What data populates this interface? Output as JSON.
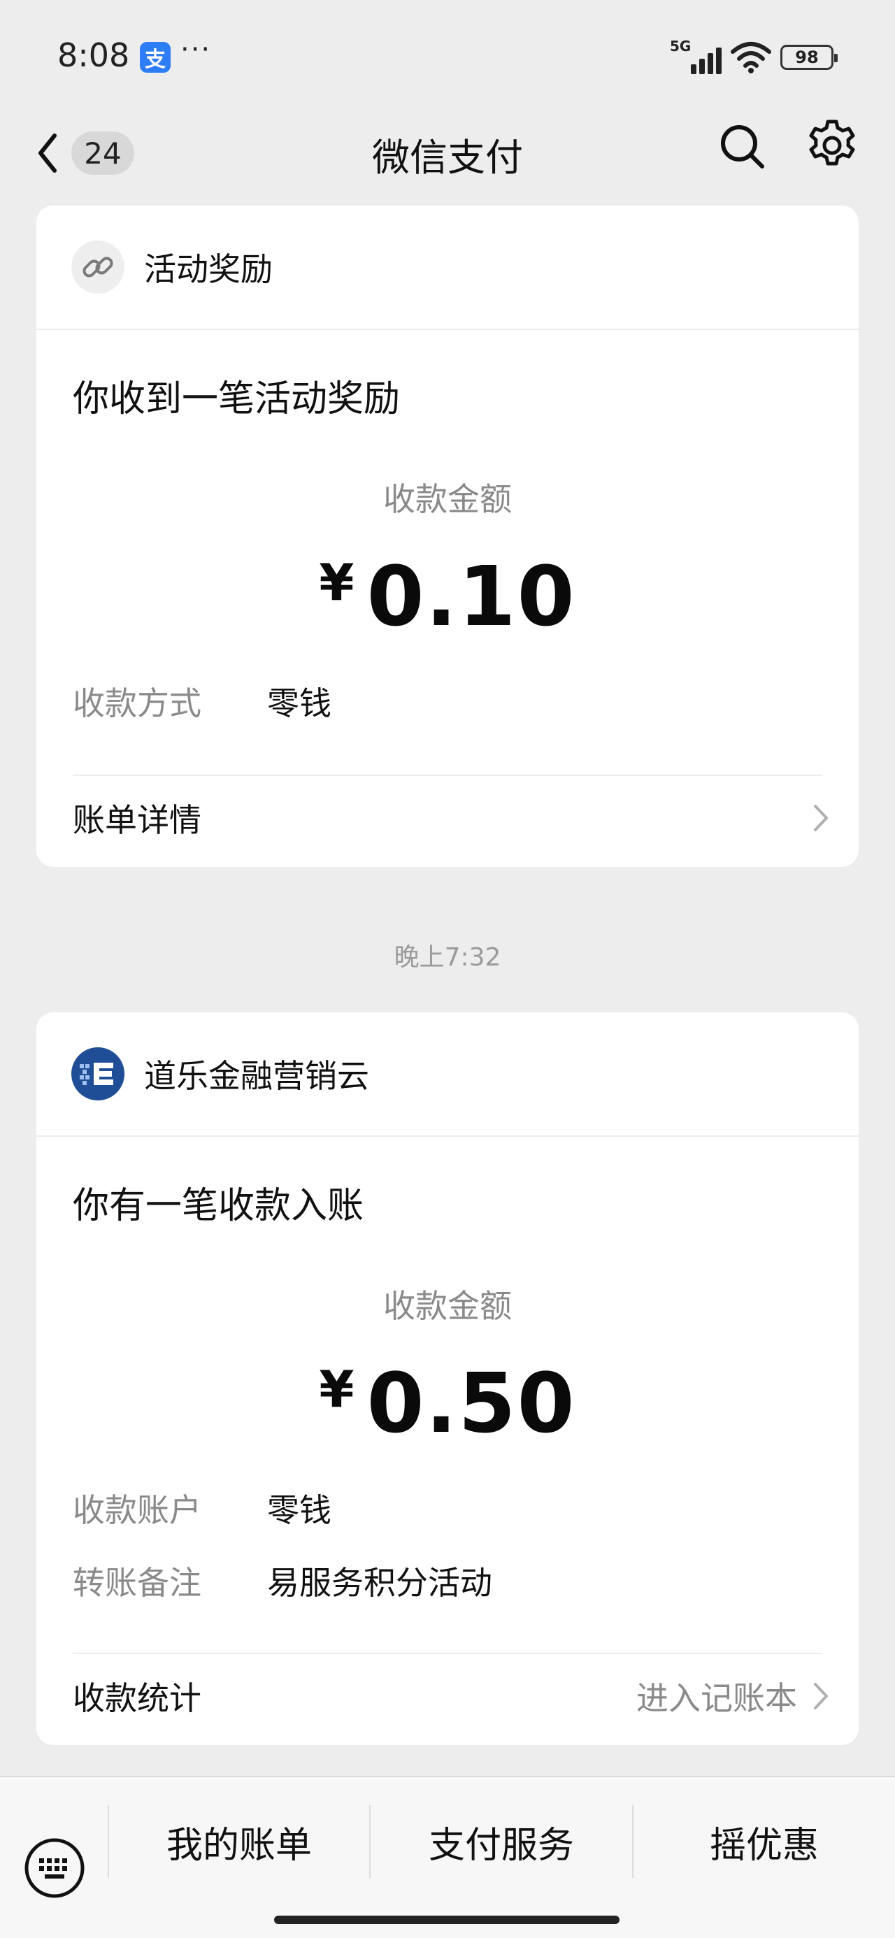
{
  "status_bar": {
    "time": "8:08",
    "app_badge": "支",
    "more_dots": "···",
    "network": "5G",
    "battery": "98"
  },
  "nav": {
    "back_count": "24",
    "title": "微信支付"
  },
  "messages": [
    {
      "sender": "活动奖励",
      "icon": "link-icon",
      "title": "你收到一笔活动奖励",
      "amount_label": "收款金额",
      "currency": "¥",
      "amount": "0.10",
      "rows": [
        {
          "label": "收款方式",
          "value": "零钱"
        }
      ],
      "footer_label": "账单详情",
      "footer_hint": ""
    },
    {
      "time": "晚上7:32",
      "sender": "道乐金融营销云",
      "icon": "daole-logo-icon",
      "title": "你有一笔收款入账",
      "amount_label": "收款金额",
      "currency": "¥",
      "amount": "0.50",
      "rows": [
        {
          "label": "收款账户",
          "value": "零钱"
        },
        {
          "label": "转账备注",
          "value": "易服务积分活动"
        }
      ],
      "footer_label": "收款统计",
      "footer_hint": "进入记账本"
    }
  ],
  "bottom_menu": [
    "我的账单",
    "支付服务",
    "摇优惠"
  ],
  "colors": {
    "background": "#ededed",
    "card": "#ffffff",
    "secondary_text": "#8a8a8a",
    "daole_blue": "#1f4e96"
  }
}
